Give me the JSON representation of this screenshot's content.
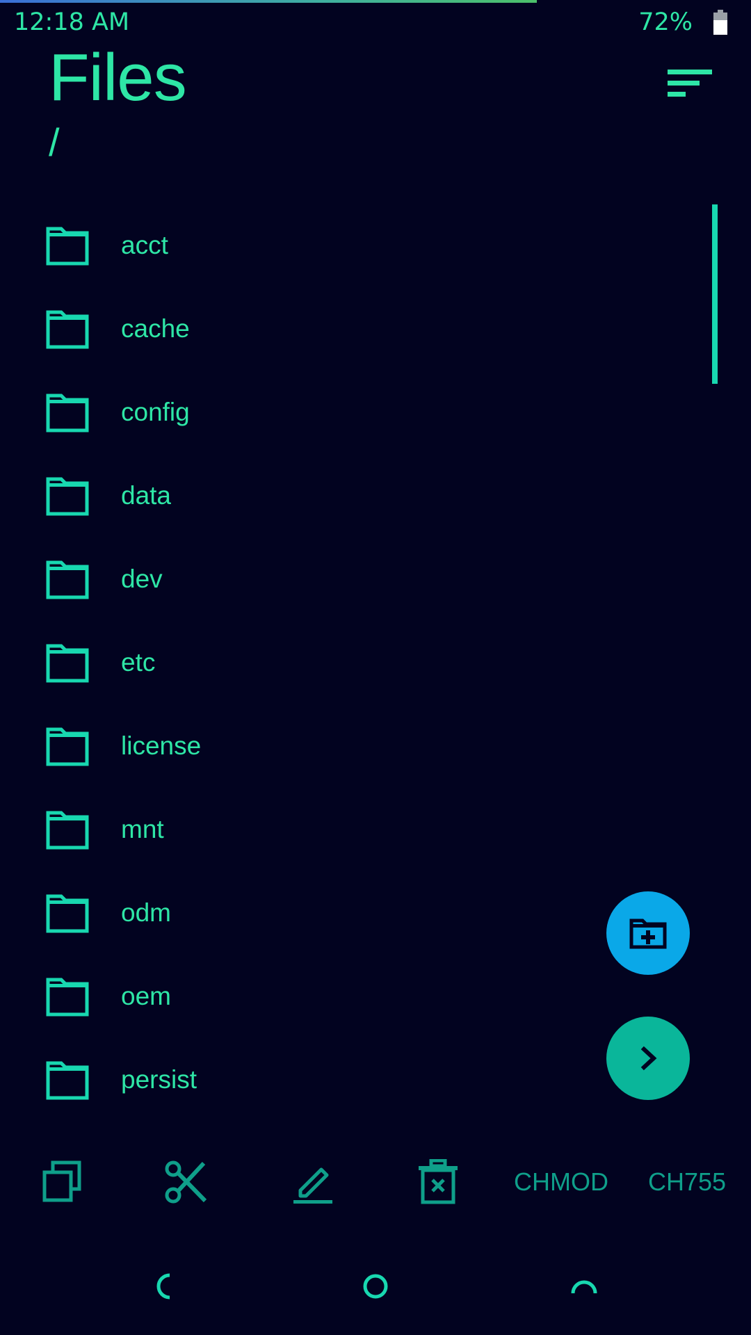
{
  "status_bar": {
    "time": "12:18 AM",
    "battery": "72%",
    "icons": [
      "battery-icon"
    ]
  },
  "header": {
    "title": "Files",
    "path": "/",
    "sort_icon": "sort-icon"
  },
  "files": [
    {
      "name": "acct",
      "icon": "folder-icon"
    },
    {
      "name": "cache",
      "icon": "folder-icon"
    },
    {
      "name": "config",
      "icon": "folder-icon"
    },
    {
      "name": "data",
      "icon": "folder-icon"
    },
    {
      "name": "dev",
      "icon": "folder-icon"
    },
    {
      "name": "etc",
      "icon": "folder-icon"
    },
    {
      "name": "license",
      "icon": "folder-icon"
    },
    {
      "name": "mnt",
      "icon": "folder-icon"
    },
    {
      "name": "odm",
      "icon": "folder-icon"
    },
    {
      "name": "oem",
      "icon": "folder-icon"
    },
    {
      "name": "persist",
      "icon": "folder-icon"
    }
  ],
  "fabs": {
    "new_folder_icon": "new-folder-icon",
    "go_icon": "chevron-right-icon"
  },
  "toolbar": {
    "copy_icon": "copy-icon",
    "cut_icon": "scissors-icon",
    "rename_icon": "edit-icon",
    "delete_icon": "delete-icon",
    "chmod_label": "CHMOD",
    "ch755_label": "CH755"
  },
  "nav_bar": {
    "back_icon": "back-icon",
    "home_icon": "home-icon",
    "recents_icon": "recents-icon"
  },
  "colors": {
    "background": "#020320",
    "accent": "#2ee6a6",
    "toolbar": "#0f9f8a",
    "fab_blue": "#0aa8e8",
    "fab_teal": "#0ab69a"
  }
}
